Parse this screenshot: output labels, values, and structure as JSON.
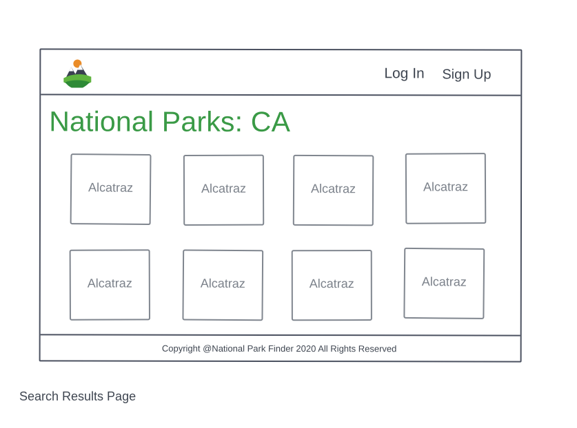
{
  "header": {
    "logo_icon": "mountain-park-logo-icon",
    "nav": {
      "login_label": "Log In",
      "signup_label": "Sign Up"
    }
  },
  "main": {
    "title": "National Parks: CA",
    "results": [
      {
        "label": "Alcatraz"
      },
      {
        "label": "Alcatraz"
      },
      {
        "label": "Alcatraz"
      },
      {
        "label": "Alcatraz"
      },
      {
        "label": "Alcatraz"
      },
      {
        "label": "Alcatraz"
      },
      {
        "label": "Alcatraz"
      },
      {
        "label": "Alcatraz"
      }
    ]
  },
  "footer": {
    "copyright": "Copyright @National Park Finder 2020 All Rights Reserved"
  },
  "caption": "Search Results Page",
  "colors": {
    "accent": "#3a9a46",
    "border": "#4b5160",
    "card_border": "#80868f"
  }
}
